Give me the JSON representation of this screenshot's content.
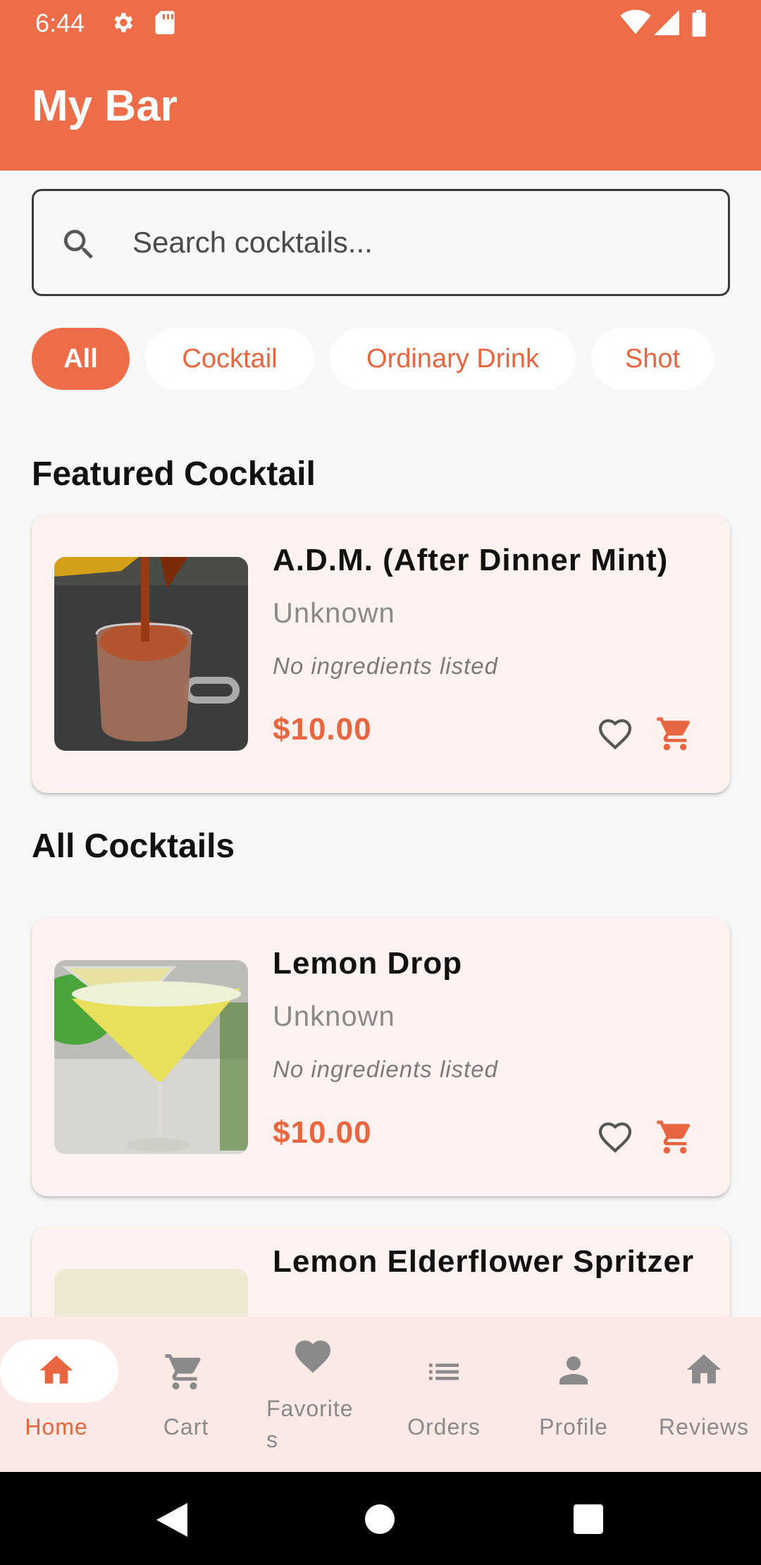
{
  "status_bar": {
    "time": "6:44",
    "icons": [
      "gear-icon",
      "sd-card-icon",
      "wifi-icon",
      "signal-icon",
      "battery-icon"
    ]
  },
  "app_bar": {
    "title": "My Bar"
  },
  "search": {
    "placeholder": "Search cocktails...",
    "value": ""
  },
  "filters": [
    {
      "label": "All",
      "selected": true
    },
    {
      "label": "Cocktail",
      "selected": false
    },
    {
      "label": "Ordinary Drink",
      "selected": false
    },
    {
      "label": "Shot",
      "selected": false
    }
  ],
  "featured": {
    "heading": "Featured Cocktail",
    "item": {
      "name": "A.D.M. (After Dinner Mint)",
      "category": "Unknown",
      "ingredients": "No ingredients listed",
      "price": "$10.00"
    }
  },
  "all": {
    "heading": "All Cocktails",
    "items": [
      {
        "name": "Lemon Drop",
        "category": "Unknown",
        "ingredients": "No ingredients listed",
        "price": "$10.00"
      },
      {
        "name": "Lemon Elderflower Spritzer"
      }
    ]
  },
  "bottom_nav": {
    "items": [
      {
        "label": "Home",
        "icon": "home-icon",
        "selected": true
      },
      {
        "label": "Cart",
        "icon": "cart-icon",
        "selected": false
      },
      {
        "label": "Favorite",
        "label_wrap": "s",
        "icon": "heart-icon",
        "selected": false
      },
      {
        "label": "Orders",
        "icon": "list-icon",
        "selected": false
      },
      {
        "label": "Profile",
        "icon": "person-icon",
        "selected": false
      },
      {
        "label": "Reviews",
        "icon": "home-icon",
        "selected": false
      }
    ]
  },
  "colors": {
    "primary": "#ec6d47",
    "accent_text": "#e7653f",
    "card_bg": "#fdf2f0",
    "nav_bg": "#fbe9e6"
  }
}
